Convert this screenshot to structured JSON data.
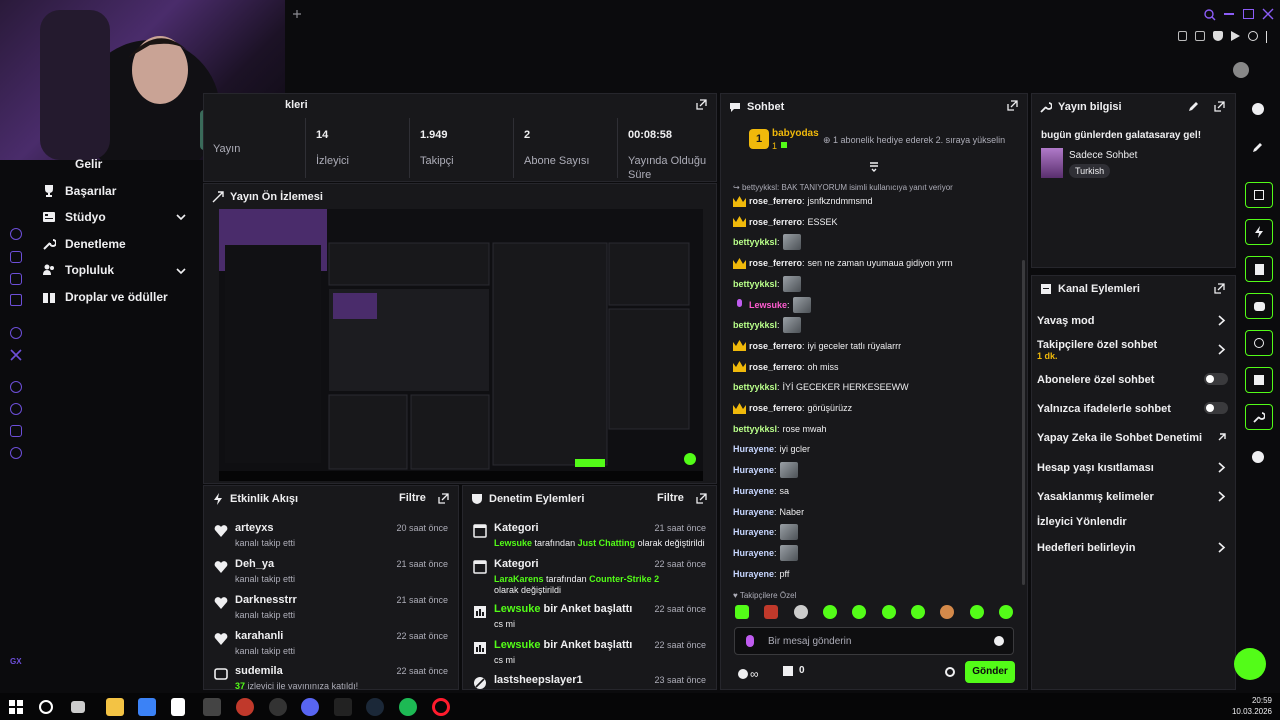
{
  "webcam": {
    "label": "webcam"
  },
  "nav": {
    "items": [
      {
        "label": "Gelir",
        "icon": "money-icon"
      },
      {
        "label": "Başarılar",
        "icon": "trophy-icon"
      },
      {
        "label": "Stüdyo",
        "icon": "studio-icon",
        "expandable": true
      },
      {
        "label": "Denetleme",
        "icon": "wrench-icon"
      },
      {
        "label": "Topluluk",
        "icon": "community-icon",
        "expandable": true
      },
      {
        "label": "Droplar ve ödüller",
        "icon": "gift-icon"
      }
    ],
    "bottom_label": "GX"
  },
  "stats": {
    "header_partial": "kleri",
    "items": [
      {
        "value": "",
        "label": "Yayın"
      },
      {
        "value": "14",
        "label": "İzleyici"
      },
      {
        "value": "1.949",
        "label": "Takipçi"
      },
      {
        "value": "2",
        "label": "Abone Sayısı"
      },
      {
        "value": "00:08:58",
        "label": "Yayında Olduğu Süre"
      }
    ]
  },
  "preview": {
    "title": "Yayın Ön İzlemesi"
  },
  "activity": {
    "title": "Etkinlik Akışı",
    "filter": "Filtre",
    "items": [
      {
        "name": "arteyxs",
        "sub": "kanalı takip etti",
        "time": "20 saat önce"
      },
      {
        "name": "Deh_ya",
        "sub": "kanalı takip etti",
        "time": "21 saat önce"
      },
      {
        "name": "Darknesstrr",
        "sub": "kanalı takip etti",
        "time": "21 saat önce"
      },
      {
        "name": "karahanli",
        "sub": "kanalı takip etti",
        "time": "22 saat önce"
      },
      {
        "name": "sudemila",
        "sub_count": "37",
        "sub": "izlevici ile vavınınıza katıldı!",
        "time": "22 saat önce"
      }
    ]
  },
  "moderation": {
    "title": "Denetim Eylemleri",
    "filter": "Filtre",
    "items": [
      {
        "title": "Kategori",
        "u": "Lewsuke",
        "m": "tarafından",
        "cat": "Just Chatting",
        "tail": "olarak değiştirildi",
        "time": "21 saat önce"
      },
      {
        "title": "Kategori",
        "u": "LaraKarens",
        "m": "tarafından",
        "cat": "Counter-Strike 2",
        "tail": "olarak değiştirildi",
        "time": "22 saat önce"
      },
      {
        "u": "Lewsuke",
        "title": "bir Anket başlattı",
        "sub": "cs mi",
        "time": "22 saat önce"
      },
      {
        "u": "Lewsuke",
        "title": "bir Anket başlattı",
        "sub": "cs mi",
        "time": "22 saat önce"
      },
      {
        "title": "lastsheepslayer1",
        "time": "23 saat önce"
      }
    ]
  },
  "chat": {
    "title": "Sohbet",
    "pinned_user": "babyodas",
    "pinned_count": "1",
    "pinned_text": "1 abonelik hediye ederek 2. sıraya yükselin",
    "reply_note": "bettyykksl: BAK TANIYORUM isimli kullanıcıya yanıt veriyor",
    "messages": [
      {
        "user": "rose_ferrero",
        "text": "jsnfkzndmmsmd",
        "type": "rose"
      },
      {
        "user": "rose_ferrero",
        "text": "ESSEK",
        "type": "rose"
      },
      {
        "user": "bettyykksl",
        "text": "",
        "type": "betty",
        "emote": true
      },
      {
        "user": "rose_ferrero",
        "text": "sen ne zaman uyumaua gidiyon yrrn",
        "type": "rose"
      },
      {
        "user": "bettyykksl",
        "text": "",
        "type": "betty",
        "emote": true
      },
      {
        "user": "Lewsuke",
        "text": "",
        "type": "lew",
        "emote": true
      },
      {
        "user": "bettyykksl",
        "text": "",
        "type": "betty",
        "emote": true
      },
      {
        "user": "rose_ferrero",
        "text": "iyi geceler tatlı rüyalarrr",
        "type": "rose"
      },
      {
        "user": "rose_ferrero",
        "text": "oh miss",
        "type": "rose"
      },
      {
        "user": "bettyykksl",
        "text": "İYİ GECEKER HERKESEEWW",
        "type": "betty"
      },
      {
        "user": "rose_ferrero",
        "text": "görüşürüzz",
        "type": "rose"
      },
      {
        "user": "bettyykksl",
        "text": "rose mwah",
        "type": "betty"
      },
      {
        "user": "Hurayene",
        "text": "iyi gcler",
        "type": "hura"
      },
      {
        "user": "Hurayene",
        "text": "",
        "type": "hura",
        "emote": true
      },
      {
        "user": "Hurayene",
        "text": "sa",
        "type": "hura"
      },
      {
        "user": "Hurayene",
        "text": "Naber",
        "type": "hura"
      },
      {
        "user": "Hurayene",
        "text": "",
        "type": "hura",
        "emote": true
      },
      {
        "user": "Hurayene",
        "text": "",
        "type": "hura",
        "emote": true
      },
      {
        "user": "Hurayene",
        "text": "pff",
        "type": "hura"
      }
    ],
    "followers_only_label": "Takipçilere Özel",
    "input_placeholder": "Bir mesaj gönderin",
    "points": "∞",
    "gifts": "0",
    "send_label": "Gönder"
  },
  "stream_info": {
    "title": "Yayın bilgisi",
    "stream_title": "bugün günlerden galatasaray gel!",
    "category": "Sadece Sohbet",
    "tag": "Turkish"
  },
  "channel_actions": {
    "title": "Kanal Eylemleri",
    "items": [
      {
        "label": "Yavaş mod",
        "kind": "chev"
      },
      {
        "label": "Takipçilere özel sohbet",
        "sub": "1 dk.",
        "kind": "chev"
      },
      {
        "label": "Abonelere özel sohbet",
        "kind": "toggle"
      },
      {
        "label": "Yalnızca ifadelerle sohbet",
        "kind": "toggle"
      },
      {
        "label": "Yapay Zeka ile Sohbet Denetimi",
        "kind": "ext"
      },
      {
        "label": "Hesap yaşı kısıtlaması",
        "kind": "chev"
      },
      {
        "label": "Yasaklanmış kelimeler",
        "kind": "chev"
      },
      {
        "label": "İzleyici Yönlendir",
        "kind": "none"
      },
      {
        "label": "Hedefleri belirleyin",
        "kind": "chev"
      }
    ]
  },
  "taskbar": {
    "time": "20:59",
    "date": "10.03.2026"
  },
  "colors": {
    "accent": "#53fc18",
    "bg": "#0b0b0d",
    "panel": "#18181b",
    "nav_icon": "#8b5cf6"
  }
}
